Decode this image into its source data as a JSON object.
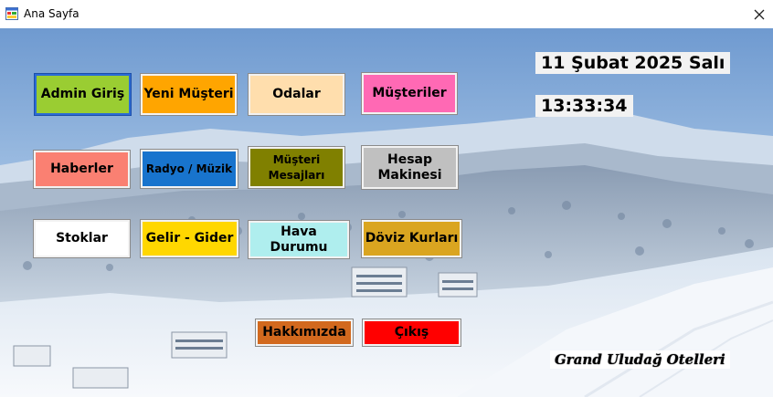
{
  "window": {
    "title": "Ana Sayfa"
  },
  "buttons": {
    "admin_giris": "Admin Giriş",
    "yeni_musteri": "Yeni Müşteri",
    "odalar": "Odalar",
    "musteriler": "Müşteriler",
    "haberler": "Haberler",
    "radyo_muzik": "Radyo / Müzik",
    "musteri_mesajlari": "Müşteri Mesajları",
    "hesap_makinesi": "Hesap Makinesi",
    "stoklar": "Stoklar",
    "gelir_gider": "Gelir - Gider",
    "hava_durumu": "Hava Durumu",
    "doviz_kurlari": "Döviz Kurları",
    "hakkimizda": "Hakkımızda",
    "cikis": "Çıkış"
  },
  "colors": {
    "admin_giris": "#9acd32",
    "yeni_musteri": "#ffa500",
    "odalar": "#ffdead",
    "musteriler": "#ff69b4",
    "haberler": "#fa8072",
    "radyo_muzik": "#1874cd",
    "musteri_mesajlari": "#808000",
    "hesap_makinesi": "#c0c0c0",
    "stoklar": "#ffffff",
    "gelir_gider": "#ffd700",
    "hava_durumu": "#afeeee",
    "doviz_kurlari": "#daa520",
    "hakkimizda": "#d2691e",
    "cikis": "#ff0000"
  },
  "date_label": "11 Şubat 2025 Salı",
  "time_label": "13:33:34",
  "brand_label": "Grand Uludağ Otelleri",
  "icons": {
    "app": "app-window-icon",
    "close": "close-icon"
  }
}
